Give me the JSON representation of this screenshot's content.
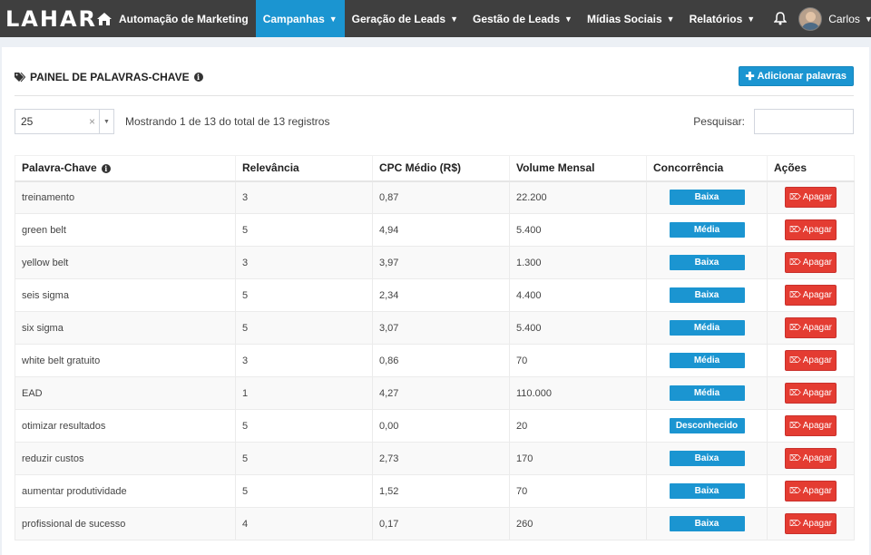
{
  "navbar": {
    "logo": "LAHAR",
    "items": [
      {
        "label": "Automação de Marketing",
        "caret": false,
        "active": false
      },
      {
        "label": "Campanhas",
        "caret": true,
        "active": true
      },
      {
        "label": "Geração de Leads",
        "caret": true,
        "active": false
      },
      {
        "label": "Gestão de Leads",
        "caret": true,
        "active": false
      },
      {
        "label": "Mídias Sociais",
        "caret": true,
        "active": false
      },
      {
        "label": "Relatórios",
        "caret": true,
        "active": false
      }
    ],
    "user_name": "Carlos",
    "icons": {
      "home": "home-icon",
      "bell": "bell-icon"
    }
  },
  "panel": {
    "title": "PAINEL DE PALAVRAS-CHAVE",
    "add_button": "Adicionar palavras",
    "page_size": "25",
    "info": "Mostrando 1 de 13 do total de 13 registros",
    "search_label": "Pesquisar:",
    "search_value": ""
  },
  "table": {
    "headers": [
      "Palavra-Chave",
      "Relevância",
      "CPC Médio (R$)",
      "Volume Mensal",
      "Concorrência",
      "Ações"
    ],
    "delete_label": "Apagar",
    "rows": [
      {
        "keyword": "treinamento",
        "relevance": "3",
        "cpc": "0,87",
        "volume": "22.200",
        "competition": "Baixa"
      },
      {
        "keyword": "green belt",
        "relevance": "5",
        "cpc": "4,94",
        "volume": "5.400",
        "competition": "Média"
      },
      {
        "keyword": "yellow belt",
        "relevance": "3",
        "cpc": "3,97",
        "volume": "1.300",
        "competition": "Baixa"
      },
      {
        "keyword": "seis sigma",
        "relevance": "5",
        "cpc": "2,34",
        "volume": "4.400",
        "competition": "Baixa"
      },
      {
        "keyword": "six sigma",
        "relevance": "5",
        "cpc": "3,07",
        "volume": "5.400",
        "competition": "Média"
      },
      {
        "keyword": "white belt gratuito",
        "relevance": "3",
        "cpc": "0,86",
        "volume": "70",
        "competition": "Média"
      },
      {
        "keyword": "EAD",
        "relevance": "1",
        "cpc": "4,27",
        "volume": "110.000",
        "competition": "Média"
      },
      {
        "keyword": "otimizar resultados",
        "relevance": "5",
        "cpc": "0,00",
        "volume": "20",
        "competition": "Desconhecido"
      },
      {
        "keyword": "reduzir custos",
        "relevance": "5",
        "cpc": "2,73",
        "volume": "170",
        "competition": "Baixa"
      },
      {
        "keyword": "aumentar produtividade",
        "relevance": "5",
        "cpc": "1,52",
        "volume": "70",
        "competition": "Baixa"
      },
      {
        "keyword": "profissional de sucesso",
        "relevance": "4",
        "cpc": "0,17",
        "volume": "260",
        "competition": "Baixa"
      }
    ]
  },
  "colors": {
    "navbar": "#3f3f3f",
    "accent": "#1b95d1",
    "danger": "#e43c32"
  }
}
